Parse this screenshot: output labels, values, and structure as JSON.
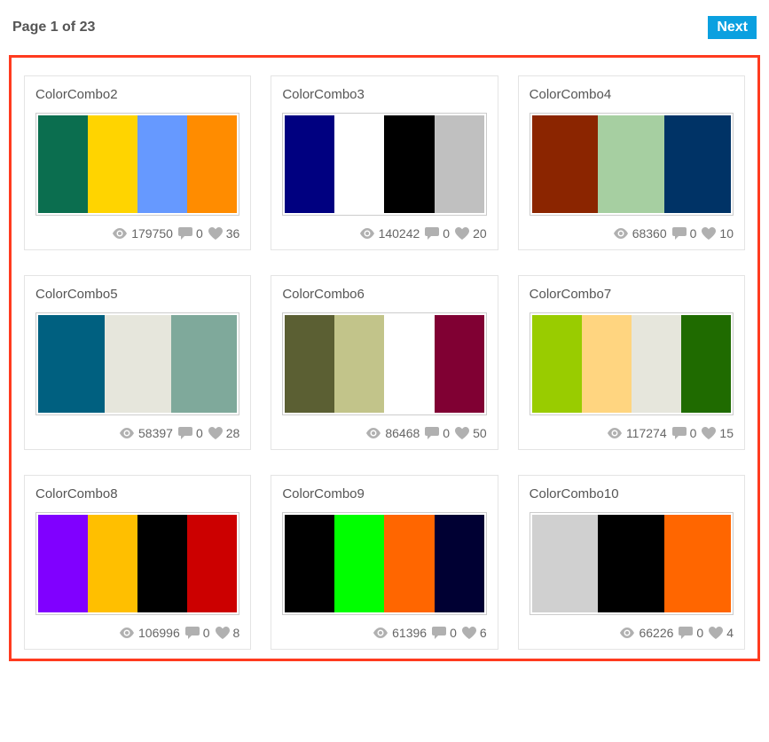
{
  "pagination": {
    "label": "Page 1 of 23",
    "next_label": "Next"
  },
  "cards": [
    {
      "title": "ColorCombo2",
      "colors": [
        "#0b6e4f",
        "#ffd400",
        "#6699ff",
        "#ff8c00"
      ],
      "views": "179750",
      "comments": "0",
      "likes": "36"
    },
    {
      "title": "ColorCombo3",
      "colors": [
        "#000080",
        "#ffffff",
        "#000000",
        "#c0c0c0"
      ],
      "views": "140242",
      "comments": "0",
      "likes": "20"
    },
    {
      "title": "ColorCombo4",
      "colors": [
        "#8b2500",
        "#a6cfa1",
        "#003366"
      ],
      "views": "68360",
      "comments": "0",
      "likes": "10"
    },
    {
      "title": "ColorCombo5",
      "colors": [
        "#006080",
        "#e6e6dc",
        "#7fa99b"
      ],
      "views": "58397",
      "comments": "0",
      "likes": "28"
    },
    {
      "title": "ColorCombo6",
      "colors": [
        "#5b5f33",
        "#c2c48a",
        "#ffffff",
        "#800033"
      ],
      "views": "86468",
      "comments": "0",
      "likes": "50"
    },
    {
      "title": "ColorCombo7",
      "colors": [
        "#99cc00",
        "#ffd580",
        "#e6e6dc",
        "#1f6b00"
      ],
      "views": "117274",
      "comments": "0",
      "likes": "15"
    },
    {
      "title": "ColorCombo8",
      "colors": [
        "#8000ff",
        "#ffbf00",
        "#000000",
        "#cc0000"
      ],
      "views": "106996",
      "comments": "0",
      "likes": "8"
    },
    {
      "title": "ColorCombo9",
      "colors": [
        "#000000",
        "#00ff00",
        "#ff6600",
        "#000033"
      ],
      "views": "61396",
      "comments": "0",
      "likes": "6"
    },
    {
      "title": "ColorCombo10",
      "colors": [
        "#d0d0d0",
        "#000000",
        "#ff6600"
      ],
      "views": "66226",
      "comments": "0",
      "likes": "4"
    }
  ]
}
